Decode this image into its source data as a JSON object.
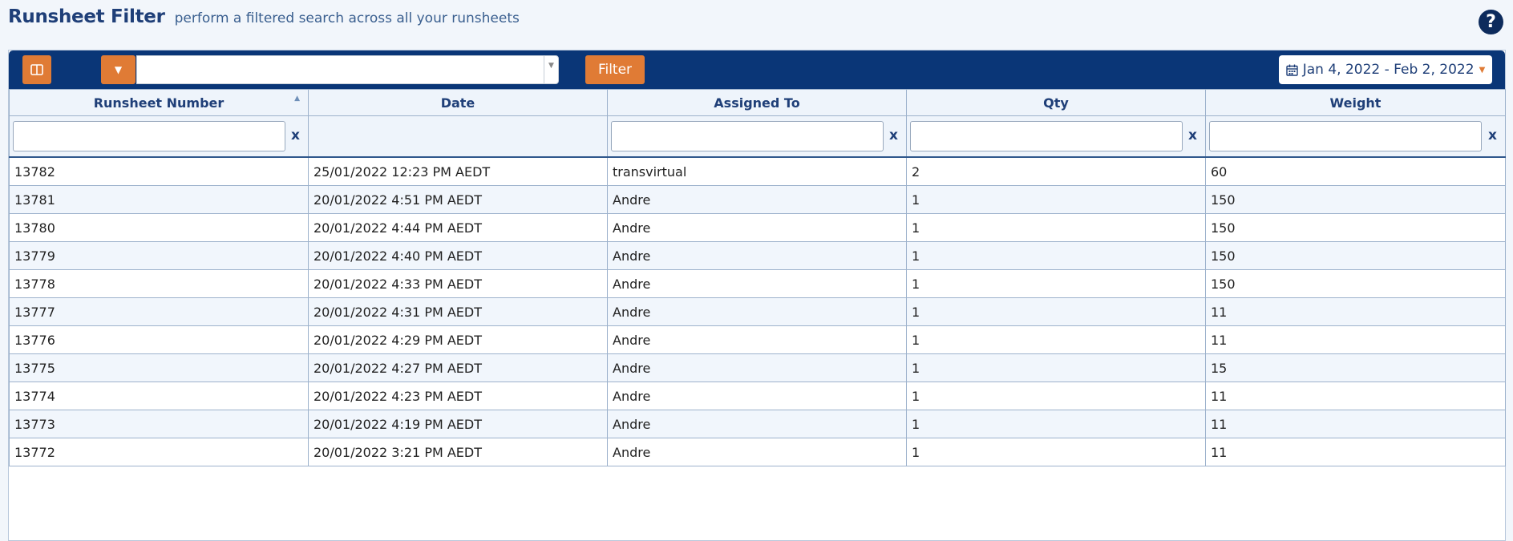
{
  "header": {
    "title": "Runsheet Filter",
    "subtitle": "perform a filtered search across all your runsheets",
    "help_label": "?"
  },
  "toolbar": {
    "columns_icon": "columns-icon",
    "dropdown_icon": "caret-down-icon",
    "search": {
      "value": "",
      "placeholder": ""
    },
    "filter_label": "Filter",
    "date_range": "Jan 4, 2022 - Feb 2, 2022",
    "calendar_icon": "calendar-icon"
  },
  "table": {
    "columns": [
      "Runsheet Number",
      "Date",
      "Assigned To",
      "Qty",
      "Weight"
    ],
    "filter_clear_label": "x",
    "rows": [
      [
        "13782",
        "25/01/2022 12:23 PM AEDT",
        "transvirtual",
        "2",
        "60"
      ],
      [
        "13781",
        "20/01/2022 4:51 PM AEDT",
        "Andre",
        "1",
        "150"
      ],
      [
        "13780",
        "20/01/2022 4:44 PM AEDT",
        "Andre",
        "1",
        "150"
      ],
      [
        "13779",
        "20/01/2022 4:40 PM AEDT",
        "Andre",
        "1",
        "150"
      ],
      [
        "13778",
        "20/01/2022 4:33 PM AEDT",
        "Andre",
        "1",
        "150"
      ],
      [
        "13777",
        "20/01/2022 4:31 PM AEDT",
        "Andre",
        "1",
        "11"
      ],
      [
        "13776",
        "20/01/2022 4:29 PM AEDT",
        "Andre",
        "1",
        "11"
      ],
      [
        "13775",
        "20/01/2022 4:27 PM AEDT",
        "Andre",
        "1",
        "15"
      ],
      [
        "13774",
        "20/01/2022 4:23 PM AEDT",
        "Andre",
        "1",
        "11"
      ],
      [
        "13773",
        "20/01/2022 4:19 PM AEDT",
        "Andre",
        "1",
        "11"
      ],
      [
        "13772",
        "20/01/2022 3:21 PM AEDT",
        "Andre",
        "1",
        "11"
      ]
    ]
  },
  "colors": {
    "toolbar_bg": "#0a3677",
    "accent_orange": "#e07b35",
    "title_blue": "#1f3f78"
  }
}
